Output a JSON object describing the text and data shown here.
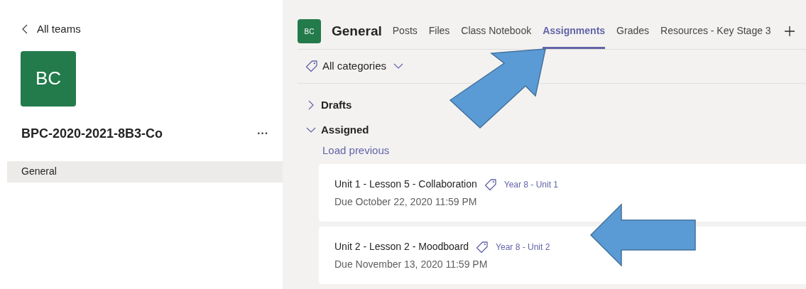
{
  "sidebar": {
    "back_link": "All teams",
    "team_avatar": "BC",
    "team_name": "BPC-2020-2021-8B3-Co",
    "more": "···",
    "channels": [
      {
        "label": "General",
        "selected": true
      }
    ]
  },
  "header": {
    "avatar": "BC",
    "channel": "General",
    "tabs": [
      {
        "label": "Posts",
        "selected": false
      },
      {
        "label": "Files",
        "selected": false
      },
      {
        "label": "Class Notebook",
        "selected": false
      },
      {
        "label": "Assignments",
        "selected": true
      },
      {
        "label": "Grades",
        "selected": false
      },
      {
        "label": "Resources - Key Stage 3",
        "selected": false
      }
    ]
  },
  "filter": {
    "label": "All categories"
  },
  "sections": [
    {
      "title": "Drafts",
      "expanded": false
    },
    {
      "title": "Assigned",
      "expanded": true,
      "load_previous": "Load previous",
      "assignments": [
        {
          "title": "Unit 1 - Lesson 5 - Collaboration",
          "tag": "Year 8 - Unit 1",
          "due": "Due October 22, 2020 11:59 PM"
        },
        {
          "title": "Unit 2 - Lesson 2 - Moodboard",
          "tag": "Year 8 - Unit 2",
          "due": "Due November 13, 2020 11:59 PM"
        }
      ]
    }
  ]
}
